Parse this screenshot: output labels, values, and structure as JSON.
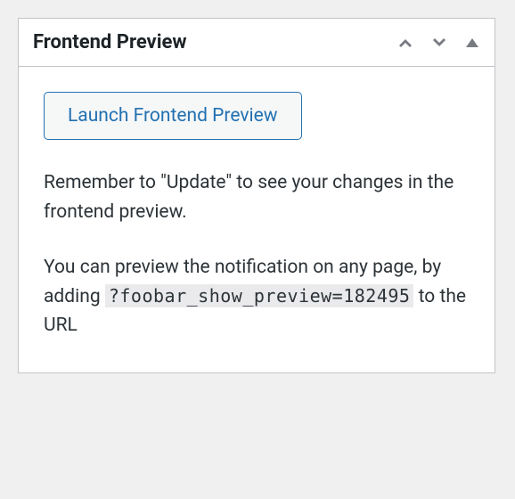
{
  "panel": {
    "title": "Frontend Preview"
  },
  "body": {
    "button_label": "Launch Frontend Preview",
    "paragraph1": "Remember to \"Update\" to see your changes in the frontend preview.",
    "paragraph2_before": "You can preview the notification on any page, by adding ",
    "paragraph2_code": "?foobar_show_preview=182495",
    "paragraph2_after": " to the URL"
  }
}
